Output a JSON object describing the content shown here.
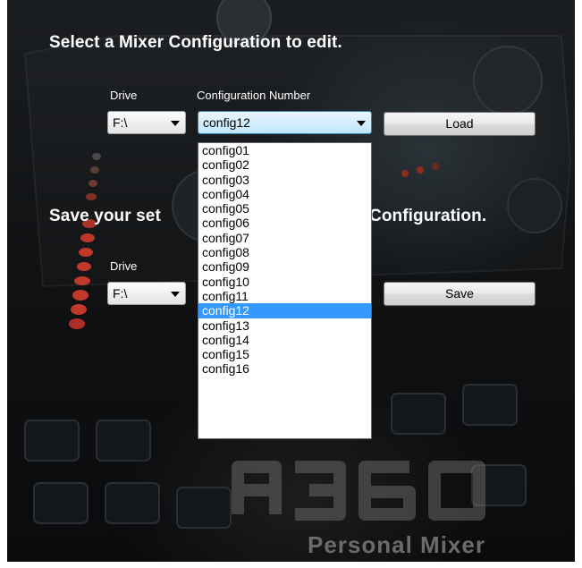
{
  "load_section": {
    "heading": "Select a Mixer Configuration to edit.",
    "drive_label": "Drive",
    "config_label": "Configuration Number",
    "drive_value": "F:\\",
    "config_value": "config12",
    "load_button": "Load"
  },
  "save_section": {
    "heading_left": "Save your set",
    "heading_right": "Configuration.",
    "drive_label": "Drive",
    "drive_value": "F:\\",
    "save_button": "Save"
  },
  "dropdown": {
    "options": [
      "config01",
      "config02",
      "config03",
      "config04",
      "config05",
      "config06",
      "config07",
      "config08",
      "config09",
      "config10",
      "config11",
      "config12",
      "config13",
      "config14",
      "config15",
      "config16"
    ],
    "selected": "config12"
  },
  "branding": {
    "logo": "A360",
    "product": "Personal Mixer"
  },
  "colors": {
    "highlight": "#3399ff",
    "background": "#101214",
    "led": "#c0392b"
  }
}
